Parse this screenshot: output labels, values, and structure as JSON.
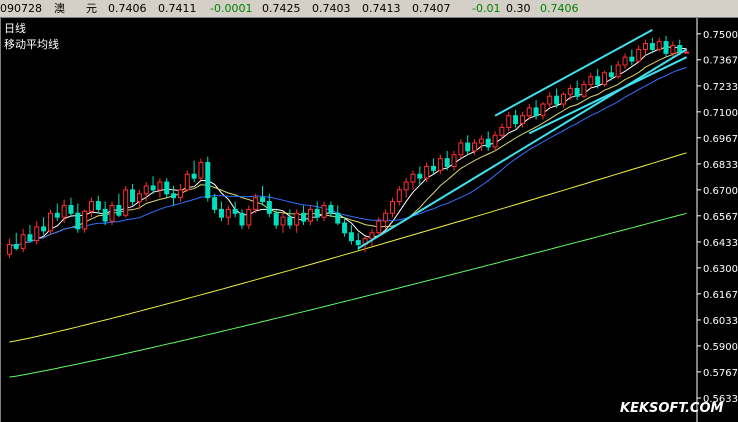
{
  "quote_bar": {
    "code": "090728",
    "name": "澳",
    "unit": "元",
    "open": "0.7406",
    "high": "0.7411",
    "change": "-0.0001",
    "low": "0.7425",
    "v1": "0.7403",
    "v2": "0.7413",
    "v3": "0.7407",
    "change2": "-0.01",
    "vol": "0.30",
    "last": "0.7406",
    "colors": {
      "up": "#00a000",
      "down": "#000000"
    }
  },
  "watermark": "KEKSOFT.COM",
  "chart_data": {
    "type": "line",
    "legend": [
      "日线",
      "移动平均线"
    ],
    "y_ticks": [
      "0.7500",
      "0.7367",
      "0.7233",
      "0.7100",
      "0.6967",
      "0.6833",
      "0.6700",
      "0.6567",
      "0.6433",
      "0.6300",
      "0.6167",
      "0.6033",
      "0.5900",
      "0.5767",
      "0.5633"
    ],
    "ylim": [
      0.5633,
      0.754
    ],
    "candles": [
      [
        0.637,
        0.645,
        0.635,
        0.642
      ],
      [
        0.642,
        0.648,
        0.639,
        0.64
      ],
      [
        0.64,
        0.65,
        0.638,
        0.647
      ],
      [
        0.647,
        0.652,
        0.643,
        0.644
      ],
      [
        0.644,
        0.654,
        0.642,
        0.651
      ],
      [
        0.651,
        0.656,
        0.647,
        0.649
      ],
      [
        0.649,
        0.66,
        0.647,
        0.658
      ],
      [
        0.658,
        0.663,
        0.654,
        0.656
      ],
      [
        0.656,
        0.665,
        0.653,
        0.662
      ],
      [
        0.662,
        0.666,
        0.656,
        0.658
      ],
      [
        0.658,
        0.663,
        0.648,
        0.65
      ],
      [
        0.65,
        0.66,
        0.648,
        0.659
      ],
      [
        0.659,
        0.666,
        0.656,
        0.664
      ],
      [
        0.664,
        0.667,
        0.658,
        0.66
      ],
      [
        0.66,
        0.664,
        0.652,
        0.654
      ],
      [
        0.654,
        0.664,
        0.652,
        0.662
      ],
      [
        0.662,
        0.668,
        0.656,
        0.657
      ],
      [
        0.657,
        0.672,
        0.656,
        0.67
      ],
      [
        0.67,
        0.673,
        0.662,
        0.664
      ],
      [
        0.664,
        0.67,
        0.66,
        0.668
      ],
      [
        0.668,
        0.674,
        0.664,
        0.672
      ],
      [
        0.672,
        0.677,
        0.668,
        0.67
      ],
      [
        0.67,
        0.676,
        0.666,
        0.674
      ],
      [
        0.674,
        0.676,
        0.666,
        0.668
      ],
      [
        0.668,
        0.672,
        0.662,
        0.666
      ],
      [
        0.666,
        0.673,
        0.664,
        0.67
      ],
      [
        0.67,
        0.68,
        0.669,
        0.678
      ],
      [
        0.678,
        0.685,
        0.674,
        0.676
      ],
      [
        0.676,
        0.686,
        0.675,
        0.684
      ],
      [
        0.684,
        0.687,
        0.664,
        0.666
      ],
      [
        0.666,
        0.668,
        0.658,
        0.66
      ],
      [
        0.66,
        0.664,
        0.654,
        0.656
      ],
      [
        0.656,
        0.662,
        0.652,
        0.66
      ],
      [
        0.66,
        0.664,
        0.656,
        0.658
      ],
      [
        0.658,
        0.66,
        0.65,
        0.652
      ],
      [
        0.652,
        0.662,
        0.65,
        0.66
      ],
      [
        0.66,
        0.668,
        0.658,
        0.666
      ],
      [
        0.666,
        0.672,
        0.662,
        0.664
      ],
      [
        0.664,
        0.668,
        0.656,
        0.658
      ],
      [
        0.658,
        0.66,
        0.65,
        0.652
      ],
      [
        0.652,
        0.658,
        0.648,
        0.656
      ],
      [
        0.656,
        0.66,
        0.65,
        0.652
      ],
      [
        0.652,
        0.66,
        0.648,
        0.658
      ],
      [
        0.658,
        0.662,
        0.652,
        0.654
      ],
      [
        0.654,
        0.662,
        0.652,
        0.66
      ],
      [
        0.66,
        0.664,
        0.654,
        0.656
      ],
      [
        0.656,
        0.664,
        0.654,
        0.662
      ],
      [
        0.662,
        0.664,
        0.656,
        0.658
      ],
      [
        0.658,
        0.662,
        0.652,
        0.653
      ],
      [
        0.653,
        0.656,
        0.646,
        0.648
      ],
      [
        0.648,
        0.652,
        0.642,
        0.644
      ],
      [
        0.644,
        0.648,
        0.639,
        0.642
      ],
      [
        0.642,
        0.646,
        0.638,
        0.645
      ],
      [
        0.645,
        0.65,
        0.641,
        0.648
      ],
      [
        0.648,
        0.656,
        0.646,
        0.654
      ],
      [
        0.654,
        0.66,
        0.65,
        0.658
      ],
      [
        0.658,
        0.666,
        0.656,
        0.664
      ],
      [
        0.664,
        0.672,
        0.662,
        0.67
      ],
      [
        0.67,
        0.676,
        0.666,
        0.674
      ],
      [
        0.674,
        0.68,
        0.67,
        0.678
      ],
      [
        0.678,
        0.682,
        0.672,
        0.676
      ],
      [
        0.676,
        0.684,
        0.674,
        0.682
      ],
      [
        0.682,
        0.686,
        0.678,
        0.68
      ],
      [
        0.68,
        0.688,
        0.678,
        0.686
      ],
      [
        0.686,
        0.69,
        0.68,
        0.682
      ],
      [
        0.682,
        0.69,
        0.68,
        0.688
      ],
      [
        0.688,
        0.696,
        0.686,
        0.694
      ],
      [
        0.694,
        0.698,
        0.688,
        0.69
      ],
      [
        0.69,
        0.696,
        0.688,
        0.694
      ],
      [
        0.694,
        0.698,
        0.69,
        0.696
      ],
      [
        0.696,
        0.7,
        0.69,
        0.692
      ],
      [
        0.692,
        0.7,
        0.69,
        0.698
      ],
      [
        0.698,
        0.704,
        0.696,
        0.702
      ],
      [
        0.702,
        0.71,
        0.7,
        0.708
      ],
      [
        0.708,
        0.711,
        0.702,
        0.704
      ],
      [
        0.704,
        0.71,
        0.702,
        0.708
      ],
      [
        0.708,
        0.714,
        0.706,
        0.712
      ],
      [
        0.712,
        0.716,
        0.706,
        0.708
      ],
      [
        0.708,
        0.715,
        0.706,
        0.714
      ],
      [
        0.714,
        0.72,
        0.712,
        0.718
      ],
      [
        0.718,
        0.722,
        0.712,
        0.714
      ],
      [
        0.714,
        0.72,
        0.712,
        0.719
      ],
      [
        0.719,
        0.724,
        0.716,
        0.722
      ],
      [
        0.722,
        0.726,
        0.716,
        0.718
      ],
      [
        0.718,
        0.726,
        0.717,
        0.724
      ],
      [
        0.724,
        0.73,
        0.722,
        0.728
      ],
      [
        0.728,
        0.732,
        0.722,
        0.724
      ],
      [
        0.724,
        0.731,
        0.723,
        0.73
      ],
      [
        0.73,
        0.734,
        0.726,
        0.728
      ],
      [
        0.728,
        0.736,
        0.727,
        0.734
      ],
      [
        0.734,
        0.74,
        0.732,
        0.738
      ],
      [
        0.738,
        0.742,
        0.734,
        0.736
      ],
      [
        0.736,
        0.744,
        0.735,
        0.742
      ],
      [
        0.742,
        0.747,
        0.739,
        0.745
      ],
      [
        0.745,
        0.748,
        0.74,
        0.742
      ],
      [
        0.742,
        0.748,
        0.741,
        0.746
      ],
      [
        0.746,
        0.749,
        0.738,
        0.74
      ],
      [
        0.74,
        0.746,
        0.738,
        0.744
      ],
      [
        0.744,
        0.747,
        0.739,
        0.741
      ],
      [
        0.7406,
        0.7425,
        0.7403,
        0.7406
      ]
    ]
  }
}
